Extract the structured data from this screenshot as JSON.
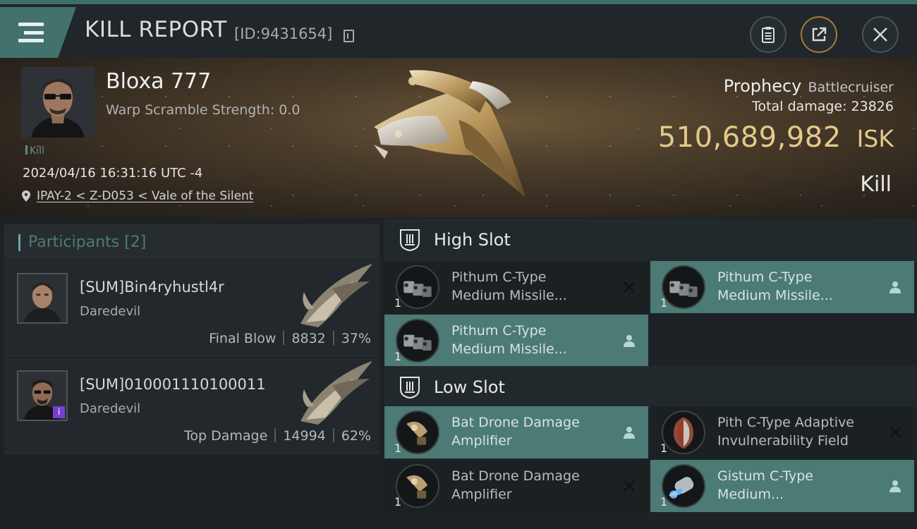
{
  "header": {
    "title": "KILL REPORT",
    "report_id": "[ID:9431654]"
  },
  "victim": {
    "name": "Bloxa 777",
    "warp_scramble": "Warp Scramble Strength: 0.0",
    "tag": "Kill",
    "datetime": "2024/04/16 16:31:16 UTC -4",
    "location": "IPAY-2 < Z-D053 < Vale of the Silent",
    "ship_name": "Prophecy",
    "ship_class": "Battlecruiser",
    "total_damage_label": "Total damage:",
    "total_damage": "23826",
    "isk_value": "510,689,982",
    "isk_unit": "ISK",
    "result": "Kill"
  },
  "participants": {
    "title": "Participants [2]",
    "items": [
      {
        "name": "[SUM]Bin4ryhustl4r",
        "ship": "Daredevil",
        "role": "Final Blow",
        "damage": "8832",
        "percent": "37%"
      },
      {
        "name": "[SUM]010001110100011",
        "ship": "Daredevil",
        "role": "Top Damage",
        "damage": "14994",
        "percent": "62%"
      }
    ]
  },
  "fitting": {
    "high_slot_title": "High Slot",
    "low_slot_title": "Low Slot",
    "high_slots": [
      {
        "qty": "1",
        "line1": "Pithum C-Type",
        "line2": "Medium Missile...",
        "status": "destroyed",
        "style": "dark"
      },
      {
        "qty": "1",
        "line1": "Pithum C-Type",
        "line2": "Medium Missile...",
        "status": "dropped",
        "style": "teal"
      },
      {
        "qty": "1",
        "line1": "Pithum C-Type",
        "line2": "Medium Missile...",
        "status": "dropped",
        "style": "teal"
      }
    ],
    "low_slots": [
      {
        "qty": "1",
        "line1": "Bat Drone Damage",
        "line2": "Amplifier",
        "status": "dropped",
        "style": "teal"
      },
      {
        "qty": "1",
        "line1": "Pith C-Type Adaptive",
        "line2": "Invulnerability Field",
        "status": "destroyed",
        "style": "dark"
      },
      {
        "qty": "1",
        "line1": "Bat Drone Damage",
        "line2": "Amplifier",
        "status": "destroyed",
        "style": "dark"
      },
      {
        "qty": "1",
        "line1": "Gistum C-Type",
        "line2": "Medium...",
        "status": "dropped",
        "style": "teal"
      }
    ]
  },
  "colors": {
    "accent_teal": "#4c7a74",
    "isk_gold": "#e5c98a",
    "header_bar": "#3f6f6a"
  }
}
